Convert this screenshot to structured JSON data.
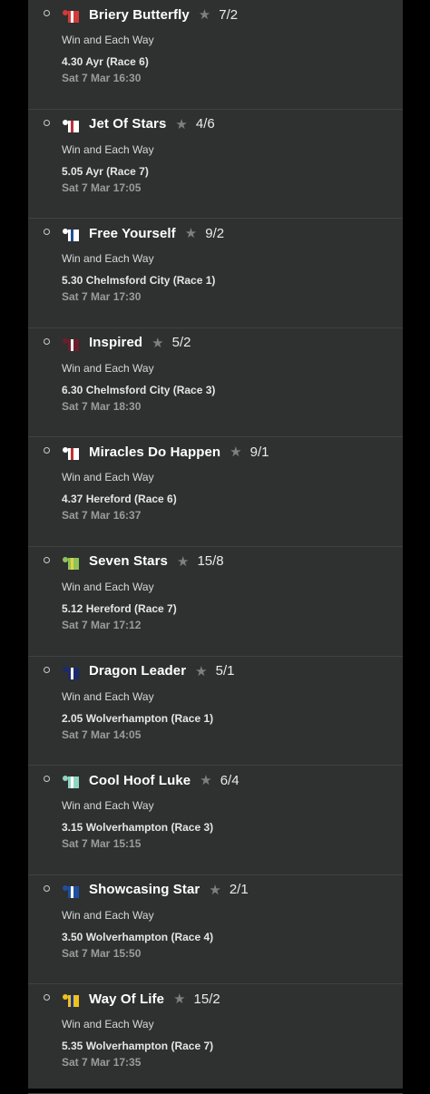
{
  "selections": [
    {
      "horse": "Briery Butterfly",
      "odds": "7/2",
      "market": "Win and Each Way",
      "race": "4.30 Ayr (Race 6)",
      "time": "Sat 7 Mar 16:30",
      "silk_icon": "jockey-silk-icon",
      "silk_colors": [
        "#d33a3a",
        "#ffffff"
      ]
    },
    {
      "horse": "Jet Of Stars",
      "odds": "4/6",
      "market": "Win and Each Way",
      "race": "5.05 Ayr (Race 7)",
      "time": "Sat 7 Mar 17:05",
      "silk_icon": "jockey-silk-icon",
      "silk_colors": [
        "#ffffff",
        "#c0303a"
      ]
    },
    {
      "horse": "Free Yourself",
      "odds": "9/2",
      "market": "Win and Each Way",
      "race": "5.30 Chelmsford City (Race 1)",
      "time": "Sat 7 Mar 17:30",
      "silk_icon": "jockey-silk-icon",
      "silk_colors": [
        "#ffffff",
        "#1e4fa0"
      ]
    },
    {
      "horse": "Inspired",
      "odds": "5/2",
      "market": "Win and Each Way",
      "race": "6.30 Chelmsford City (Race 3)",
      "time": "Sat 7 Mar 18:30",
      "silk_icon": "jockey-silk-icon",
      "silk_colors": [
        "#6a1f2a",
        "#ffffff"
      ]
    },
    {
      "horse": "Miracles Do Happen",
      "odds": "9/1",
      "market": "Win and Each Way",
      "race": "4.37 Hereford (Race 6)",
      "time": "Sat 7 Mar 16:37",
      "silk_icon": "jockey-silk-icon",
      "silk_colors": [
        "#ffffff",
        "#c23030"
      ]
    },
    {
      "horse": "Seven Stars",
      "odds": "15/8",
      "market": "Win and Each Way",
      "race": "5.12 Hereford (Race 7)",
      "time": "Sat 7 Mar 17:12",
      "silk_icon": "jockey-silk-icon",
      "silk_colors": [
        "#8cc45a",
        "#e8d040"
      ]
    },
    {
      "horse": "Dragon Leader",
      "odds": "5/1",
      "market": "Win and Each Way",
      "race": "2.05 Wolverhampton (Race 1)",
      "time": "Sat 7 Mar 14:05",
      "silk_icon": "jockey-silk-icon",
      "silk_colors": [
        "#1b2a6b",
        "#ffffff"
      ]
    },
    {
      "horse": "Cool Hoof Luke",
      "odds": "6/4",
      "market": "Win and Each Way",
      "race": "3.15 Wolverhampton (Race 3)",
      "time": "Sat 7 Mar 15:15",
      "silk_icon": "jockey-silk-icon",
      "silk_colors": [
        "#8fd6c2",
        "#ffffff"
      ]
    },
    {
      "horse": "Showcasing Star",
      "odds": "2/1",
      "market": "Win and Each Way",
      "race": "3.50 Wolverhampton (Race 4)",
      "time": "Sat 7 Mar 15:50",
      "silk_icon": "jockey-silk-icon",
      "silk_colors": [
        "#1e4fa0",
        "#ffffff"
      ]
    },
    {
      "horse": "Way Of Life",
      "odds": "15/2",
      "market": "Win and Each Way",
      "race": "5.35 Wolverhampton (Race 7)",
      "time": "Sat 7 Mar 17:35",
      "silk_icon": "jockey-silk-icon",
      "silk_colors": [
        "#f0c020",
        "#1b3a8b"
      ]
    }
  ],
  "star_icon": "star-icon",
  "radio_icon": "radio-circle-icon"
}
